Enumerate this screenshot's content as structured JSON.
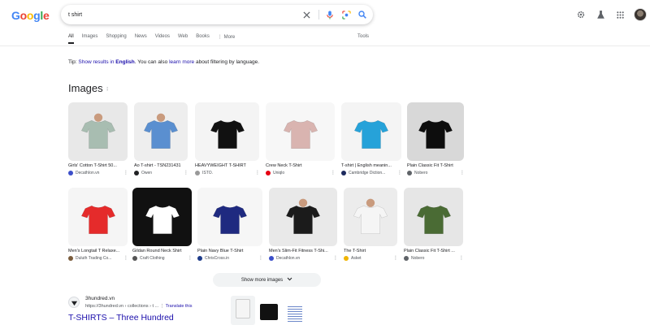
{
  "logo": {
    "letters": [
      "G",
      "o",
      "o",
      "g",
      "l",
      "e"
    ],
    "colors": [
      "#4285f4",
      "#ea4335",
      "#fbbc05",
      "#4285f4",
      "#34a853",
      "#ea4335"
    ]
  },
  "search": {
    "query": "t shirt"
  },
  "icons": {
    "clear": "close-icon",
    "voice": "mic-icon",
    "lens": "lens-icon",
    "search": "search-icon",
    "settings": "gear-icon",
    "labs": "flask-icon",
    "apps": "apps-grid-icon"
  },
  "tabs": [
    "All",
    "Images",
    "Shopping",
    "News",
    "Videos",
    "Web",
    "Books",
    "More"
  ],
  "tools_label": "Tools",
  "tip": {
    "prefix": "Tip: ",
    "show_link": "Show results in",
    "lang_link": "English",
    "middle": ". You can also ",
    "learn_link": "learn more",
    "suffix": " about filtering by language."
  },
  "images_heading": "Images",
  "images_info_icon": "⁝",
  "images": [
    {
      "caption": "Girls' Cotton T-Shirt 50...",
      "source": "DecathIon.vn",
      "fav": "#3c4fc9",
      "bg": "#e8e8e8",
      "shirt": "#a8bdb1",
      "person": true
    },
    {
      "caption": "Ao T-shirt - TSN231431",
      "source": "Owen",
      "fav": "#202124",
      "bg": "#eeeeee",
      "shirt": "#5a8fd0",
      "person": true
    },
    {
      "caption": "HEAVYWEIGHT T-SHIRT",
      "source": "ISTO.",
      "fav": "#999999",
      "bg": "#f4f4f4",
      "shirt": "#111111",
      "person": false
    },
    {
      "caption": "Crew Neck T-Shirt",
      "source": "Uniqlo",
      "fav": "#e60012",
      "bg": "#f7f7f7",
      "shirt": "#d9b4b0",
      "person": false
    },
    {
      "caption": "T-shirt | English meanin...",
      "source": "Cambridge Diction...",
      "fav": "#1d2a5e",
      "bg": "#f4f4f4",
      "shirt": "#26a2d9",
      "person": false
    },
    {
      "caption": "Plain Classic Fit T-Shirt",
      "source": "Nobero",
      "fav": "#5f6368",
      "bg": "#d8d8d8",
      "shirt": "#0d0d0d",
      "person": false
    },
    {
      "caption": "Men's Longtail T Relaxe...",
      "source": "Duluth Trading Co...",
      "fav": "#7a5c3c",
      "bg": "#f5f5f5",
      "shirt": "#e52b2b",
      "person": false
    },
    {
      "caption": "Gildan Round Neck Shirt",
      "source": "Craft Clothing",
      "fav": "#555555",
      "bg": "#111111",
      "shirt": "#ffffff",
      "person": false
    },
    {
      "caption": "Plain Navy Blue T-Shirt",
      "source": "ChrisCross.in",
      "fav": "#1d3b8a",
      "bg": "#f6f6f6",
      "shirt": "#1f2a80",
      "person": false
    },
    {
      "caption": "Men's Slim-Fit Fitness T-Shi...",
      "source": "Decathlon.vn",
      "fav": "#3c4fc9",
      "bg": "#e9e9e9",
      "shirt": "#1b1b1b",
      "person": true
    },
    {
      "caption": "The T-Shirt",
      "source": "Asket",
      "fav": "#f0b400",
      "bg": "#ececec",
      "shirt": "#f5f5f5",
      "person": true
    },
    {
      "caption": "Plain Classic Fit T-Shirt ...",
      "source": "Nobero",
      "fav": "#5f6368",
      "bg": "#e6e6e6",
      "shirt": "#4a6b34",
      "person": false
    }
  ],
  "show_more": "Show more images",
  "result": {
    "site_name": "3hundred.vn",
    "url": "https://3hundred.vn › collections › t ...",
    "translate": "Translate this",
    "title": "T-SHIRTS – Three Hundred"
  }
}
